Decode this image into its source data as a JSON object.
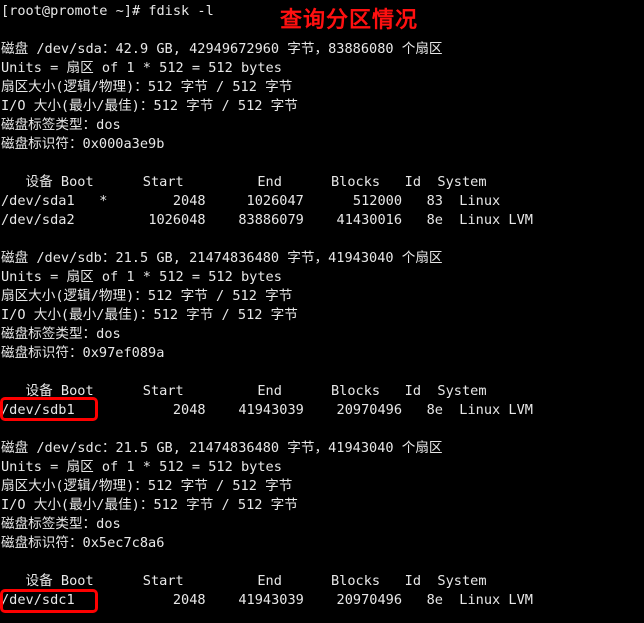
{
  "terminal": {
    "background_color": "#000000",
    "text_color": "#e8e8e8",
    "annotation_color": "#ff1010",
    "highlight_color": "#fe0000",
    "prompt_line": "[root@promote ~]# fdisk -l",
    "annotation_text": "查询分区情况",
    "lines": [
      "[root@promote ~]# fdisk -l",
      "",
      "磁盘 /dev/sda：42.9 GB, 42949672960 字节，83886080 个扇区",
      "Units = 扇区 of 1 * 512 = 512 bytes",
      "扇区大小(逻辑/物理)：512 字节 / 512 字节",
      "I/O 大小(最小/最佳)：512 字节 / 512 字节",
      "磁盘标签类型：dos",
      "磁盘标识符：0x000a3e9b",
      "",
      "   设备 Boot      Start         End      Blocks   Id  System",
      "/dev/sda1   *        2048     1026047      512000   83  Linux",
      "/dev/sda2         1026048    83886079    41430016   8e  Linux LVM",
      "",
      "磁盘 /dev/sdb：21.5 GB, 21474836480 字节，41943040 个扇区",
      "Units = 扇区 of 1 * 512 = 512 bytes",
      "扇区大小(逻辑/物理)：512 字节 / 512 字节",
      "I/O 大小(最小/最佳)：512 字节 / 512 字节",
      "磁盘标签类型：dos",
      "磁盘标识符：0x97ef089a",
      "",
      "   设备 Boot      Start         End      Blocks   Id  System",
      "/dev/sdb1            2048    41943039    20970496   8e  Linux LVM",
      "",
      "磁盘 /dev/sdc：21.5 GB, 21474836480 字节，41943040 个扇区",
      "Units = 扇区 of 1 * 512 = 512 bytes",
      "扇区大小(逻辑/物理)：512 字节 / 512 字节",
      "I/O 大小(最小/最佳)：512 字节 / 512 字节",
      "磁盘标签类型：dos",
      "磁盘标识符：0x5ec7c8a6",
      "",
      "   设备 Boot      Start         End      Blocks   Id  System",
      "/dev/sdc1            2048    41943039    20970496   8e  Linux LVM"
    ],
    "disks": [
      {
        "device": "/dev/sda",
        "size_human": "42.9 GB",
        "size_bytes": "42949672960",
        "sectors": "83886080",
        "units": "扇区 of 1 * 512 = 512 bytes",
        "sector_size": "512 字节 / 512 字节",
        "io_size": "512 字节 / 512 字节",
        "label_type": "dos",
        "identifier": "0x000a3e9b",
        "columns": [
          "设备",
          "Boot",
          "Start",
          "End",
          "Blocks",
          "Id",
          "System"
        ],
        "partitions": [
          {
            "device": "/dev/sda1",
            "boot": "*",
            "start": "2048",
            "end": "1026047",
            "blocks": "512000",
            "id": "83",
            "system": "Linux",
            "highlighted": false
          },
          {
            "device": "/dev/sda2",
            "boot": "",
            "start": "1026048",
            "end": "83886079",
            "blocks": "41430016",
            "id": "8e",
            "system": "Linux LVM",
            "highlighted": false
          }
        ]
      },
      {
        "device": "/dev/sdb",
        "size_human": "21.5 GB",
        "size_bytes": "21474836480",
        "sectors": "41943040",
        "units": "扇区 of 1 * 512 = 512 bytes",
        "sector_size": "512 字节 / 512 字节",
        "io_size": "512 字节 / 512 字节",
        "label_type": "dos",
        "identifier": "0x97ef089a",
        "columns": [
          "设备",
          "Boot",
          "Start",
          "End",
          "Blocks",
          "Id",
          "System"
        ],
        "partitions": [
          {
            "device": "/dev/sdb1",
            "boot": "",
            "start": "2048",
            "end": "41943039",
            "blocks": "20970496",
            "id": "8e",
            "system": "Linux LVM",
            "highlighted": true
          }
        ]
      },
      {
        "device": "/dev/sdc",
        "size_human": "21.5 GB",
        "size_bytes": "21474836480",
        "sectors": "41943040",
        "units": "扇区 of 1 * 512 = 512 bytes",
        "sector_size": "512 字节 / 512 字节",
        "io_size": "512 字节 / 512 字节",
        "label_type": "dos",
        "identifier": "0x5ec7c8a6",
        "columns": [
          "设备",
          "Boot",
          "Start",
          "End",
          "Blocks",
          "Id",
          "System"
        ],
        "partitions": [
          {
            "device": "/dev/sdc1",
            "boot": "",
            "start": "2048",
            "end": "41943039",
            "blocks": "20970496",
            "id": "8e",
            "system": "Linux LVM",
            "highlighted": true
          }
        ]
      }
    ]
  }
}
